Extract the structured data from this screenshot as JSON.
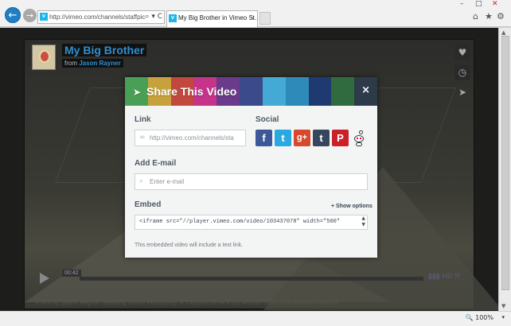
{
  "browser": {
    "address": "http://vimeo.com/channels/staffpic",
    "address_icons": "⌕ ▾ C",
    "tab_title": "My Big Brother in Vimeo St...",
    "tab_close": "×",
    "zoom": "100%",
    "vimeo_glyph": "v"
  },
  "video": {
    "title": "My Big Brother",
    "from_prefix": "from",
    "author": "Jason Rayner",
    "time": "00:42",
    "hd_label": "HD",
    "caption": "A film by Jason Rayner debuting online exclusively in Cartoon Brew's 5th annual Student Animation Festival"
  },
  "modal": {
    "title": "Share This Video",
    "close": "×",
    "header_colors": [
      "#4a9f57",
      "#c7a23c",
      "#c0483e",
      "#c5338a",
      "#6a3b8a",
      "#3b4a8a",
      "#45a9d6",
      "#2e8ab8",
      "#1e3a70",
      "#2f6b3e",
      "#2d3a4a"
    ],
    "link": {
      "label": "Link",
      "value": "http://vimeo.com/channels/sta"
    },
    "social": {
      "label": "Social",
      "buttons": [
        {
          "name": "facebook",
          "glyph": "f",
          "color": "#3b5998"
        },
        {
          "name": "twitter",
          "glyph": "t",
          "color": "#2aa9e0"
        },
        {
          "name": "googleplus",
          "glyph": "g+",
          "color": "#d6492f"
        },
        {
          "name": "tumblr",
          "glyph": "t",
          "color": "#36465d"
        },
        {
          "name": "pinterest",
          "glyph": "P",
          "color": "#cb2027"
        }
      ]
    },
    "email": {
      "label": "Add E-mail",
      "placeholder": "Enter e-mail"
    },
    "embed": {
      "label": "Embed",
      "show_options": "+ Show options",
      "code": "<iframe src=\"//player.vimeo.com/video/103437078\" width=\"500\"",
      "note": "This embedded video will include a text link."
    }
  }
}
